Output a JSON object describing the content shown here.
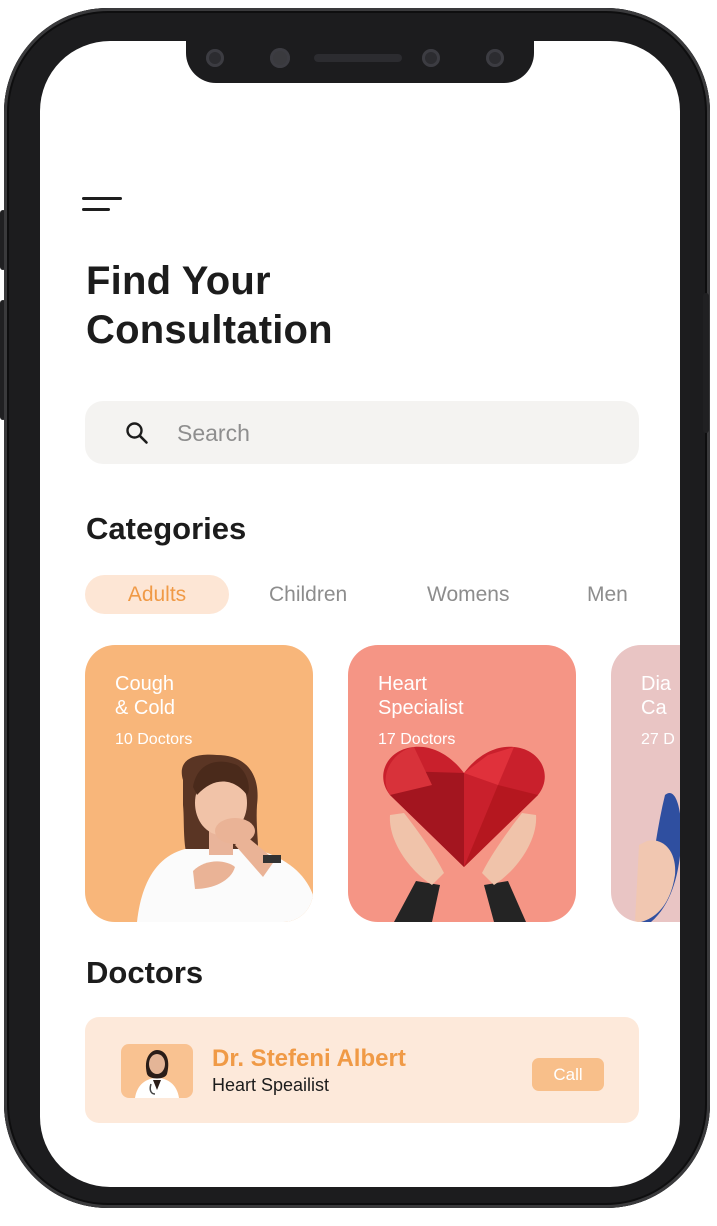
{
  "header": {
    "title_line1": "Find Your",
    "title_line2": "Consultation"
  },
  "search": {
    "placeholder": "Search"
  },
  "categories": {
    "heading": "Categories",
    "tabs": [
      {
        "label": "Adults",
        "active": true
      },
      {
        "label": "Children",
        "active": false
      },
      {
        "label": "Womens",
        "active": false
      },
      {
        "label": "Men",
        "active": false
      }
    ],
    "cards": [
      {
        "line1": "Cough",
        "line2": "& Cold",
        "count": "10 Doctors",
        "color": "#f8b67a"
      },
      {
        "line1": "Heart",
        "line2": "Specialist",
        "count": "17 Doctors",
        "color": "#f59585"
      },
      {
        "line1": "Dia",
        "line2": "Ca",
        "count": "27 D",
        "color": "#e9c5c4"
      }
    ]
  },
  "doctors": {
    "heading": "Doctors",
    "items": [
      {
        "name": "Dr. Stefeni Albert",
        "specialty": "Heart Speailist",
        "action": "Call"
      }
    ]
  },
  "colors": {
    "accent": "#f09a46",
    "accent_light": "#fde6d5",
    "heading": "#1c1c1c"
  }
}
